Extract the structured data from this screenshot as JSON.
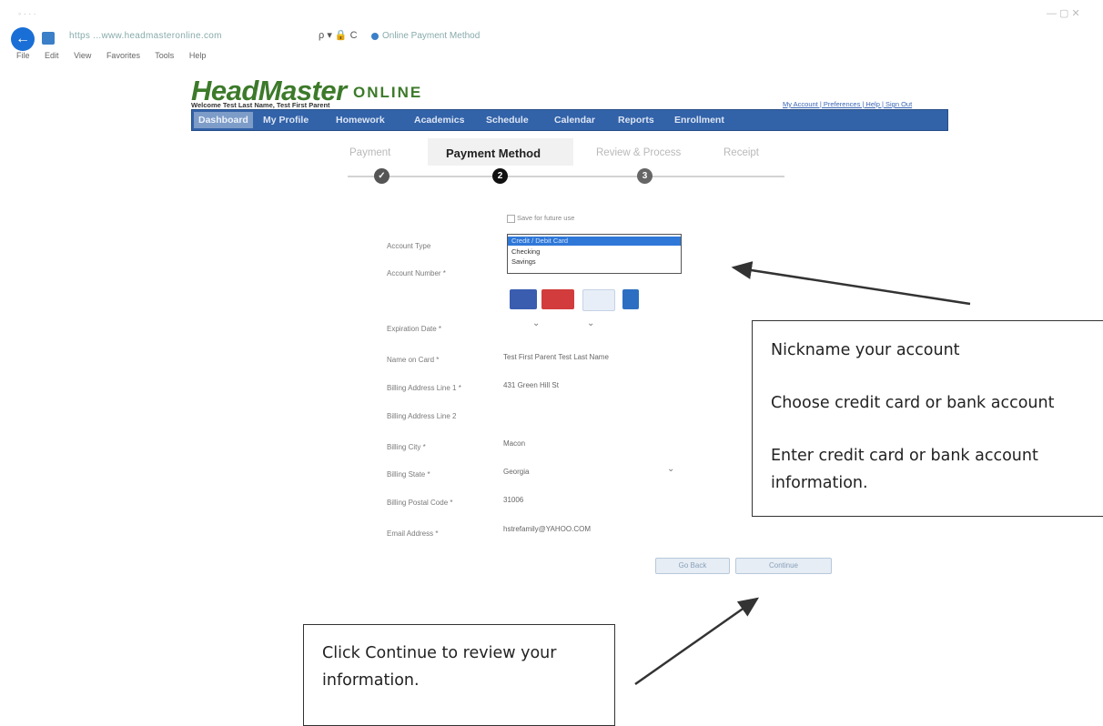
{
  "browser": {
    "url": "https  ...www.headmasteronline.com",
    "address_controls": "ρ ▾ 🔒 C",
    "tab_title": "Online Payment Method",
    "menu": [
      "File",
      "Edit",
      "View",
      "Favorites",
      "Tools",
      "Help"
    ]
  },
  "site": {
    "logo": "HeadMaster",
    "logo_suffix": "ONLINE",
    "welcome": "Welcome Test Last Name, Test First Parent",
    "top_links": "My Account | Preferences | Help | Sign Out",
    "nav": [
      "Dashboard",
      "My Profile",
      "Homework",
      "Academics",
      "Schedule",
      "Calendar",
      "Reports",
      "Enrollment"
    ]
  },
  "steps": [
    {
      "label": "Payment",
      "marker": "✓"
    },
    {
      "label": "Payment Method",
      "marker": "2"
    },
    {
      "label": "Review & Process",
      "marker": "3"
    },
    {
      "label": "Receipt",
      "marker": ""
    }
  ],
  "form": {
    "save_label": "Save for future use",
    "account_type_label": "Account Type",
    "account_type_options": [
      "Credit / Debit Card",
      "Checking",
      "Savings"
    ],
    "account_number_label": "Account Number *",
    "expiration_label": "Expiration Date *",
    "name_label": "Name on Card *",
    "name_value": "Test First Parent Test Last Name",
    "addr1_label": "Billing Address Line 1 *",
    "addr1_value": "431 Green Hill St",
    "addr2_label": "Billing Address Line 2",
    "city_label": "Billing City *",
    "city_value": "Macon",
    "state_label": "Billing State *",
    "state_value": "Georgia",
    "postal_label": "Billing Postal Code *",
    "postal_value": "31006",
    "email_label": "Email Address *",
    "email_value": "hstrefamily@YAHOO.COM",
    "back_button": "Go Back",
    "continue_button": "Continue"
  },
  "callouts": {
    "right": [
      "Nickname your account",
      "Choose credit card or bank account",
      "Enter credit card or bank account",
      "information."
    ],
    "bottom": "Click Continue to review your information."
  },
  "colors": {
    "nav": "#3262a8",
    "logo": "#3c7a2a",
    "selected_option": "#2f78d8"
  }
}
